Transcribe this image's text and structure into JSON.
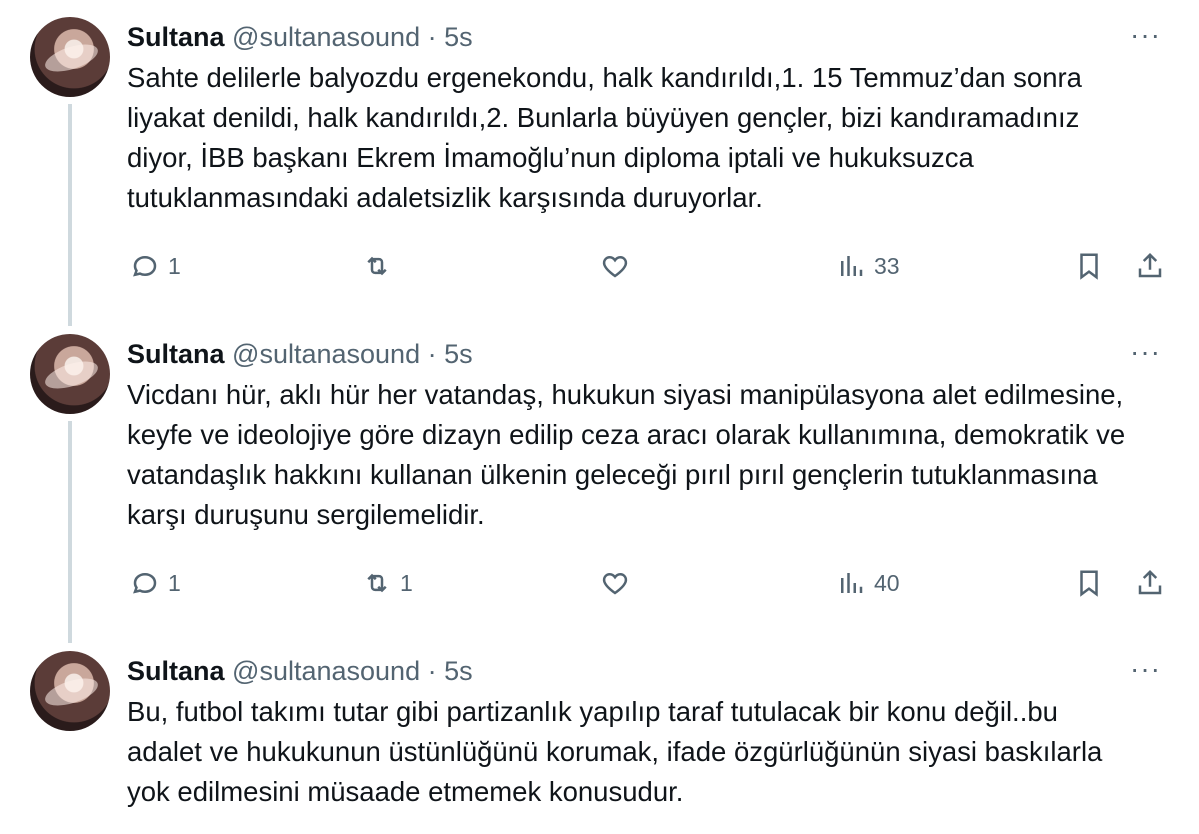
{
  "tweets": [
    {
      "name": "Sultana",
      "handle": "@sultanasound",
      "separator": "·",
      "time": "5s",
      "text": "Sahte delilerle balyozdu ergenekondu, halk kandırıldı,1. 15 Temmuz’dan sonra liyakat denildi, halk kandırıldı,2. Bunlarla büyüyen gençler, bizi kandıramadınız diyor, İBB başkanı Ekrem İmamoğlu’nun diploma iptali ve hukuksuzca tutuklanmasındaki adaletsizlik karşısında duruyorlar.",
      "replies": "1",
      "retweets": "",
      "likes": "",
      "views": "33"
    },
    {
      "name": "Sultana",
      "handle": "@sultanasound",
      "separator": "·",
      "time": "5s",
      "text": "Vicdanı hür, aklı hür her vatandaş, hukukun siyasi manipülasyona alet edilmesine, keyfe ve ideolojiye göre dizayn edilip ceza aracı olarak kullanımına, demokratik ve vatandaşlık hakkını kullanan ülkenin geleceği pırıl pırıl gençlerin tutuklanmasına karşı duruşunu sergilemelidir.",
      "replies": "1",
      "retweets": "1",
      "likes": "",
      "views": "40"
    },
    {
      "name": "Sultana",
      "handle": "@sultanasound",
      "separator": "·",
      "time": "5s",
      "text": "Bu, futbol takımı tutar gibi partizanlık yapılıp taraf tutulacak bir konu değil..bu adalet ve hukukunun üstünlüğünü korumak, ifade özgürlüğünün siyasi baskılarla yok edilmesini müsaade etmemek konusudur."
    }
  ],
  "more_label": "···",
  "icons": {
    "reply": "reply-icon",
    "retweet": "retweet-icon",
    "like": "heart-icon",
    "views": "views-icon",
    "bookmark": "bookmark-icon",
    "share": "share-icon"
  },
  "colors": {
    "text": "#0f1419",
    "muted": "#536471",
    "thread_line": "#cfd9de"
  }
}
